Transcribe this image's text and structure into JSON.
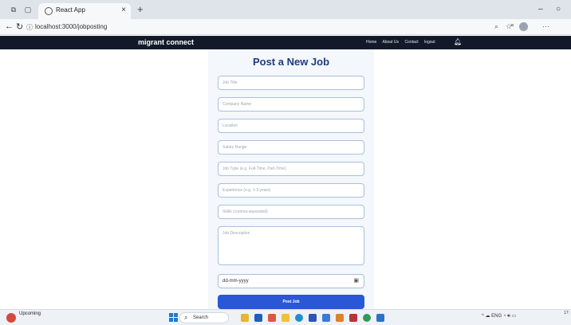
{
  "browser": {
    "tab_title": "React App",
    "tab_close": "×",
    "new_tab": "+",
    "url": "localhost:3000/jobposting",
    "minimize": "–",
    "maximize": "○"
  },
  "navbar": {
    "brand": "migrant connect",
    "links": [
      "Home",
      "About Us",
      "Contact",
      "logout"
    ]
  },
  "form": {
    "title": "Post a New Job",
    "fields": [
      {
        "placeholder": "Job Title"
      },
      {
        "placeholder": "Company Name"
      },
      {
        "placeholder": "Location"
      },
      {
        "placeholder": "Salary Range"
      },
      {
        "placeholder": "Job Type (e.g. Full-Time, Part-Time)"
      },
      {
        "placeholder": "Experience (e.g. 1-3 years)"
      },
      {
        "placeholder": "Skills (comma-separated)"
      },
      {
        "placeholder": "Job Description"
      }
    ],
    "date_value": "dd-mm-yyyy",
    "submit_label": "Post Job"
  },
  "taskbar": {
    "weather_title": "Upcoming",
    "weather_sub": "",
    "search_label": "Search",
    "lang": "ENG",
    "time": "17:"
  },
  "colors": {
    "navbar": "#121a2a",
    "accent": "#2a57d6",
    "title": "#1f3b80"
  }
}
